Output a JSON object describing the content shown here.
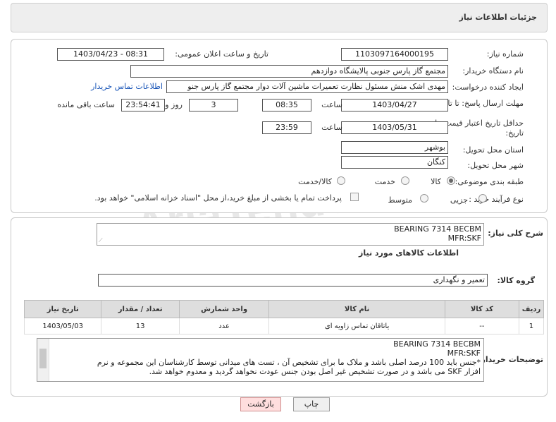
{
  "header": {
    "title": "جزئیات اطلاعات نیاز"
  },
  "form": {
    "need_number": {
      "label": "شماره نیاز:",
      "value": "1103097164000195"
    },
    "announce_datetime": {
      "label": "تاریخ و ساعت اعلان عمومی:",
      "value": "1403/04/23 - 08:31"
    },
    "buyer_org": {
      "label": "نام دستگاه خریدار:",
      "value": "مجتمع گاز پارس جنوبی  پالایشگاه دوازدهم"
    },
    "requester": {
      "label": "ایجاد کننده درخواست:",
      "value": "مهدی اشک منش مسئول نظارت تعمیرات ماشین آلات دوار مجتمع گاز پارس جنو",
      "contact_link": "اطلاعات تماس خریدار"
    },
    "reply_deadline": {
      "label": "مهلت ارسال پاسخ: تا تاریخ:",
      "date": "1403/04/27",
      "time_label": "ساعت",
      "time": "08:35",
      "days": "3",
      "days_label": "روز و",
      "remaining": "23:54:41",
      "remaining_label": "ساعت باقی مانده"
    },
    "price_validity": {
      "label": "حداقل تاریخ اعتبار قیمت: تا تاریخ:",
      "date": "1403/05/31",
      "time_label": "ساعت",
      "time": "23:59"
    },
    "province": {
      "label": "استان محل تحویل:",
      "value": "بوشهر"
    },
    "city": {
      "label": "شهر محل تحویل:",
      "value": "کنگان"
    },
    "category": {
      "label": "طبقه بندی موضوعی:",
      "options": [
        "کالا",
        "خدمت",
        "کالا/خدمت"
      ],
      "selected": "کالا"
    },
    "purchase_type": {
      "label": "نوع فرآیند خرید :",
      "options": [
        "جزیی",
        "متوسط"
      ],
      "note": "پرداخت تمام یا بخشی از مبلغ خرید،از محل \"اسناد خزانه اسلامی\" خواهد بود."
    }
  },
  "summary": {
    "label": "شرح کلی نیاز:",
    "text_line1": "BEARING 7314 BECBM",
    "text_line2": "MFR:SKF"
  },
  "goods_info": {
    "title": "اطلاعات کالاهای مورد نیاز"
  },
  "goods_group": {
    "label": "گروه کالا:",
    "value": "تعمیر و نگهداری"
  },
  "table": {
    "headers": [
      "ردیف",
      "کد کالا",
      "نام کالا",
      "واحد شمارش",
      "تعداد / مقدار",
      "تاریخ نیاز"
    ],
    "rows": [
      [
        "1",
        "--",
        "یاتاقان تماس زاویه ای",
        "عدد",
        "13",
        "1403/05/03"
      ]
    ]
  },
  "buyer_notes": {
    "label": "توضیحات خریدار:",
    "line1": "BEARING 7314 BECBM",
    "line2": "MFR:SKF",
    "line3": "*جنس باید 100 درصد اصلی باشد و ملاک ما برای تشخیص آن ، تست های میدانی توسط کارشناسان این مجموعه و نرم",
    "line4": "افزار SKF می باشد و در صورت تشخیص غیر اصل بودن جنس عودت نخواهد گردید و معدوم خواهد شد."
  },
  "buttons": {
    "print": "چاپ",
    "back": "بازگشت"
  },
  "watermark": "AriaTender.net"
}
